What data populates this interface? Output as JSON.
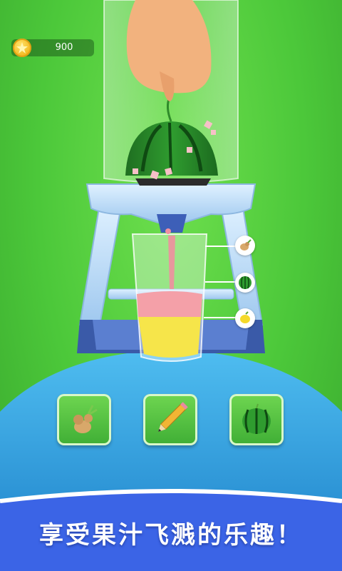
{
  "hud": {
    "coins": "900",
    "coin_icon": "star-coin-icon"
  },
  "ingredients": [
    {
      "id": "ginger",
      "icon": "ginger-icon"
    },
    {
      "id": "pencil",
      "icon": "pencil-icon"
    },
    {
      "id": "watermelon",
      "icon": "watermelon-icon"
    }
  ],
  "mix_preview": [
    {
      "id": "ginger",
      "icon": "ginger-icon"
    },
    {
      "id": "watermelon",
      "icon": "watermelon-icon"
    },
    {
      "id": "lemon",
      "icon": "lemon-icon"
    }
  ],
  "banner": {
    "text": "享受果汁飞溅的乐趣！"
  },
  "colors": {
    "background": "#4cc83a",
    "juice_pink": "#f4a0a8",
    "juice_yellow": "#f6e54a",
    "platform": "#2f9fd9"
  }
}
